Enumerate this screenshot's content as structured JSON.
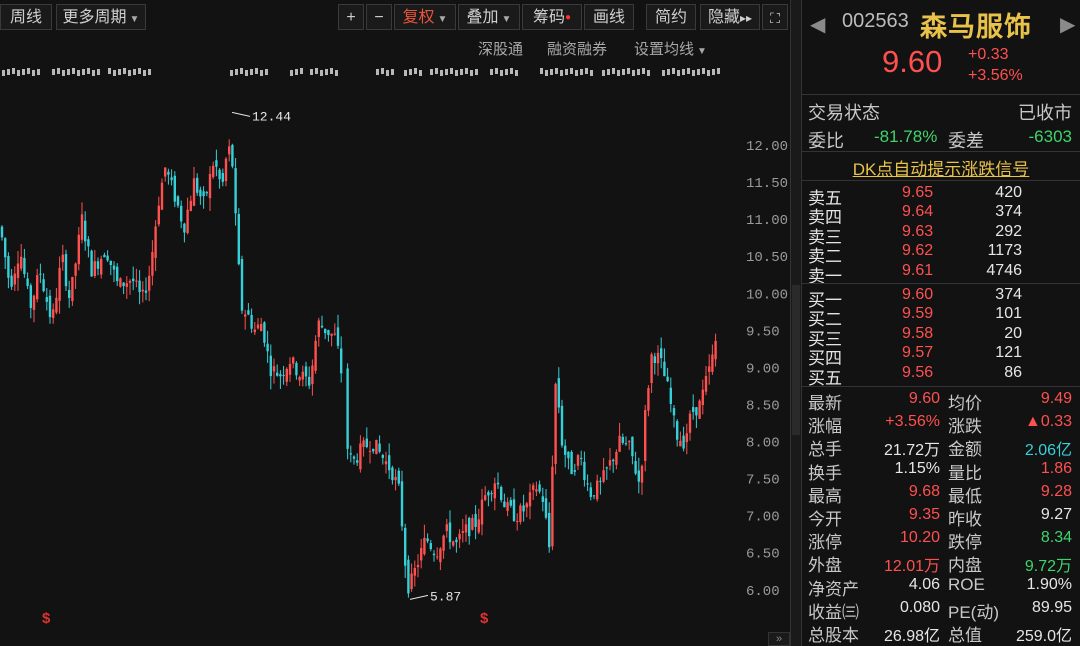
{
  "toolbar": {
    "weekly": "周线",
    "more_periods": "更多周期",
    "zoom_in": "+",
    "zoom_out": "−",
    "restore_rights": "复权",
    "overlay": "叠加",
    "chips": "筹码",
    "draw": "画线",
    "simple": "简约",
    "hide": "隐藏",
    "forward": "▸▸",
    "fullscreen": "⛶"
  },
  "subbar": {
    "sz_connect": "深股通",
    "margin": "融资融券",
    "ma_settings": "设置均线"
  },
  "chart_data": {
    "type": "candlestick",
    "yticks": [
      12.0,
      11.5,
      11.0,
      10.5,
      10.0,
      9.5,
      9.0,
      8.5,
      8.0,
      7.5,
      7.0,
      6.5,
      6.0
    ],
    "ylim": [
      5.7,
      12.85
    ],
    "annotations": [
      {
        "label": "12.44",
        "value": 12.44
      },
      {
        "label": "5.87",
        "value": 5.87
      }
    ]
  },
  "axis_labels": [
    "12.00",
    "11.50",
    "11.00",
    "10.50",
    "10.00",
    "9.50",
    "9.00",
    "8.50",
    "8.00",
    "7.50",
    "7.00",
    "6.50",
    "6.00"
  ],
  "chart_labels": {
    "high": "12.44",
    "low": "5.87"
  },
  "header": {
    "code": "002563",
    "name": "森马服饰",
    "price": "9.60",
    "change": "+0.33",
    "change_pct": "+3.56%"
  },
  "status": {
    "label": "交易状态",
    "value": "已收市"
  },
  "commission": {
    "ratio_label": "委比",
    "ratio_value": "-81.78%",
    "diff_label": "委差",
    "diff_value": "-6303"
  },
  "dk_signal": "DK点自动提示涨跌信号",
  "asks": [
    {
      "label": "卖五",
      "price": "9.65",
      "vol": "420"
    },
    {
      "label": "卖四",
      "price": "9.64",
      "vol": "374"
    },
    {
      "label": "卖三",
      "price": "9.63",
      "vol": "292"
    },
    {
      "label": "卖二",
      "price": "9.62",
      "vol": "1173"
    },
    {
      "label": "卖一",
      "price": "9.61",
      "vol": "4746"
    }
  ],
  "bids": [
    {
      "label": "买一",
      "price": "9.60",
      "vol": "374"
    },
    {
      "label": "买二",
      "price": "9.59",
      "vol": "101"
    },
    {
      "label": "买三",
      "price": "9.58",
      "vol": "20"
    },
    {
      "label": "买四",
      "price": "9.57",
      "vol": "121"
    },
    {
      "label": "买五",
      "price": "9.56",
      "vol": "86"
    }
  ],
  "quotes": [
    {
      "l1": "最新",
      "v1": "9.60",
      "c1": "red",
      "l2": "均价",
      "v2": "9.49",
      "c2": "red"
    },
    {
      "l1": "涨幅",
      "v1": "+3.56%",
      "c1": "red",
      "l2": "涨跌",
      "v2": "▲0.33",
      "c2": "red"
    },
    {
      "l1": "总手",
      "v1": "21.72万",
      "c1": "white",
      "l2": "金额",
      "v2": "2.06亿",
      "c2": "cyan"
    },
    {
      "l1": "换手",
      "v1": "1.15%",
      "c1": "white",
      "l2": "量比",
      "v2": "1.86",
      "c2": "red"
    },
    {
      "l1": "最高",
      "v1": "9.68",
      "c1": "red",
      "l2": "最低",
      "v2": "9.28",
      "c2": "red"
    },
    {
      "l1": "今开",
      "v1": "9.35",
      "c1": "red",
      "l2": "昨收",
      "v2": "9.27",
      "c2": "white"
    },
    {
      "l1": "涨停",
      "v1": "10.20",
      "c1": "red",
      "l2": "跌停",
      "v2": "8.34",
      "c2": "green"
    },
    {
      "l1": "外盘",
      "v1": "12.01万",
      "c1": "red",
      "l2": "内盘",
      "v2": "9.72万",
      "c2": "green"
    },
    {
      "l1": "净资产",
      "v1": "4.06",
      "c1": "white",
      "l2": "ROE",
      "v2": "1.90%",
      "c2": "white"
    },
    {
      "l1": "收益㈢",
      "v1": "0.080",
      "c1": "white",
      "l2": "PE(动)",
      "v2": "89.95",
      "c2": "white"
    },
    {
      "l1": "总股本",
      "v1": "26.98亿",
      "c1": "white",
      "l2": "总值",
      "v2": "259.0亿",
      "c2": "white"
    }
  ],
  "colors": {
    "up": "#ff5050",
    "down": "#35d0d8",
    "accent": "#e9c24a"
  }
}
